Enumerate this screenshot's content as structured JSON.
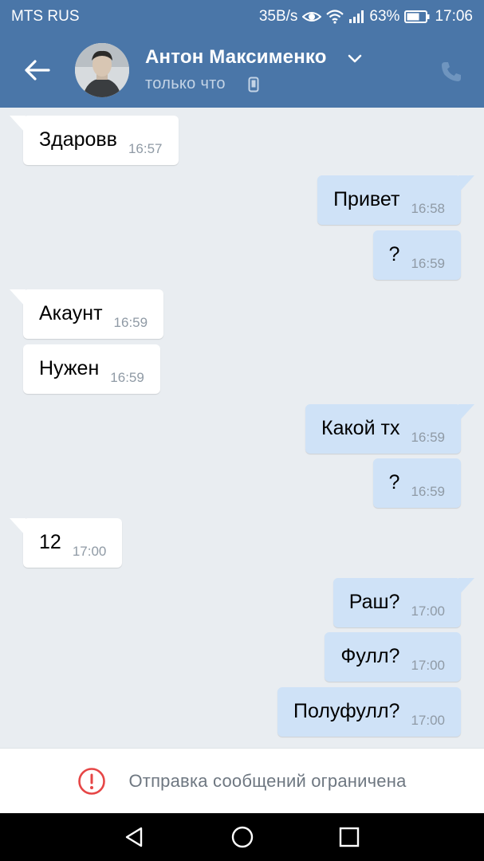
{
  "status_bar": {
    "carrier": "MTS RUS",
    "speed": "35B/s",
    "battery": "63%",
    "time": "17:06"
  },
  "header": {
    "contact_name": "Антон Максименко",
    "status": "только что",
    "accent_color": "#4a76a8"
  },
  "messages": [
    {
      "direction": "in",
      "text": "Здаровв",
      "time": "16:57",
      "tail": true
    },
    {
      "direction": "out",
      "text": "Привет",
      "time": "16:58",
      "tail": true
    },
    {
      "direction": "out",
      "text": "?",
      "time": "16:59",
      "tail": false
    },
    {
      "direction": "in",
      "text": "Акаунт",
      "time": "16:59",
      "tail": true
    },
    {
      "direction": "in",
      "text": "Нужен",
      "time": "16:59",
      "tail": false
    },
    {
      "direction": "out",
      "text": "Какой тх",
      "time": "16:59",
      "tail": true
    },
    {
      "direction": "out",
      "text": "?",
      "time": "16:59",
      "tail": false
    },
    {
      "direction": "in",
      "text": "12",
      "time": "17:00",
      "tail": true
    },
    {
      "direction": "out",
      "text": "Раш?",
      "time": "17:00",
      "tail": true
    },
    {
      "direction": "out",
      "text": "Фулл?",
      "time": "17:00",
      "tail": false
    },
    {
      "direction": "out",
      "text": "Полуфулл?",
      "time": "17:00",
      "tail": false
    }
  ],
  "restriction": {
    "text": "Отправка сообщений ограничена",
    "icon": "exclamation-circle-icon",
    "icon_color": "#e64646"
  },
  "nav": {
    "back": "back-triangle-icon",
    "home": "home-circle-icon",
    "recents": "recents-square-icon"
  }
}
